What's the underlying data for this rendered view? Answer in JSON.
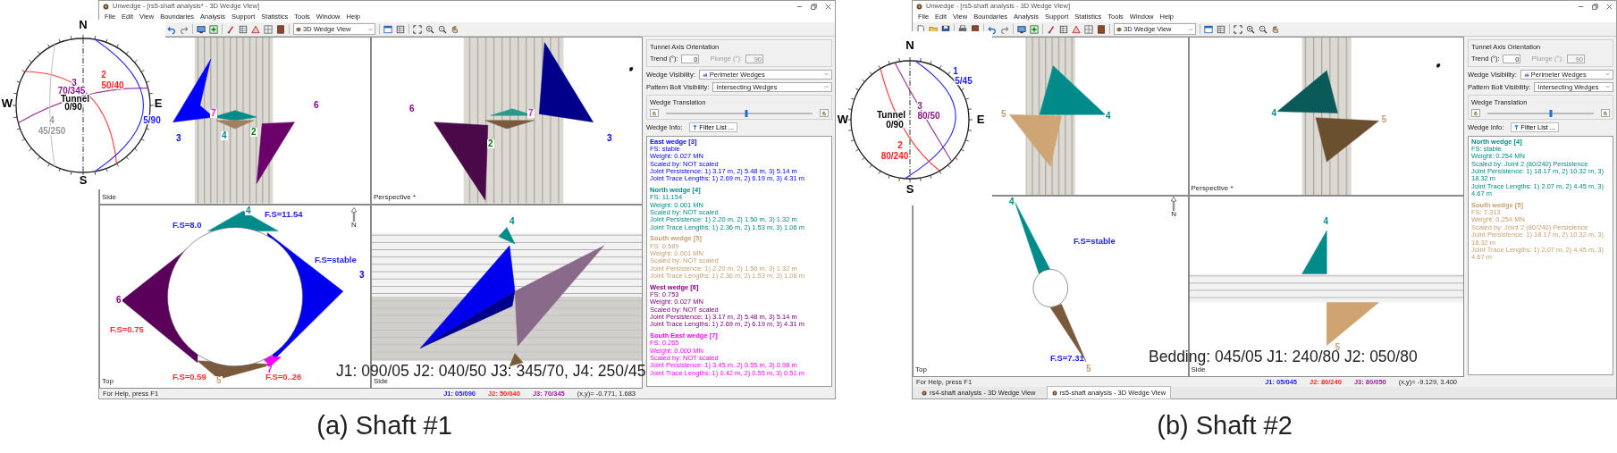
{
  "figures": [
    {
      "caption": "(a) Shaft #1",
      "annotation": "J1: 090/05 J2: 040/50 J3: 345/70, J4: 250/45",
      "stereonet": {
        "labels": [
          {
            "text": "N",
            "color": "#000000"
          },
          {
            "text": "S",
            "color": "#000000"
          },
          {
            "text": "W",
            "color": "#000000"
          },
          {
            "text": "E",
            "color": "#000000"
          },
          {
            "text": "2",
            "color": "#ff2020"
          },
          {
            "text": "50/40",
            "color": "#ff2020"
          },
          {
            "text": "3",
            "color": "#8b1a8b"
          },
          {
            "text": "70/345",
            "color": "#8b1a8b"
          },
          {
            "text": "Tunnel",
            "color": "#000000"
          },
          {
            "text": "0/90",
            "color": "#000000"
          },
          {
            "text": "4",
            "color": "#999999"
          },
          {
            "text": "45/250",
            "color": "#999999"
          },
          {
            "text": "5/90",
            "color": "#2020ff"
          }
        ],
        "planes": [
          {
            "color": "#ff4040"
          },
          {
            "color": "#9b3a9b"
          },
          {
            "color": "#c8c8c8"
          },
          {
            "color": "#3030ff"
          }
        ]
      },
      "window": {
        "title": "Unwedge - [rs5-shaft analysis* - 3D Wedge View]",
        "menu": [
          "File",
          "Edit",
          "View",
          "Boundaries",
          "Analysis",
          "Support",
          "Statistics",
          "Tools",
          "Window",
          "Help"
        ],
        "view_select": "3D Wedge View",
        "viewports": [
          {
            "label": "Side",
            "kind": "side-shaft",
            "tags": [
              {
                "text": "3",
                "color": "#0000ff"
              },
              {
                "text": "7",
                "color": "#ff00ff"
              },
              {
                "text": "4",
                "color": "#008b8b"
              },
              {
                "text": "2",
                "color": "#008000"
              },
              {
                "text": "6",
                "color": "#8b008b"
              }
            ]
          },
          {
            "label": "Perspective *",
            "kind": "perspective",
            "tags": [
              {
                "text": "6",
                "color": "#8b008b"
              },
              {
                "text": "2",
                "color": "#008000"
              },
              {
                "text": "7",
                "color": "#ff00ff"
              },
              {
                "text": "3",
                "color": "#0000ff"
              }
            ]
          },
          {
            "label": "Top",
            "kind": "top",
            "north_label": "N",
            "tags": [
              {
                "text": "4",
                "color": "#008b8b"
              },
              {
                "text": "6",
                "color": "#8b008b"
              },
              {
                "text": "3",
                "color": "#0000ff"
              },
              {
                "text": "7",
                "color": "#ff00ff"
              },
              {
                "text": "5",
                "color": "#c8a070"
              }
            ],
            "fs_labels": [
              {
                "text": "F.S=8.0",
                "color": "#2020ff"
              },
              {
                "text": "F.S=11.54",
                "color": "#2020ff"
              },
              {
                "text": "F.S=stable",
                "color": "#2020ff"
              },
              {
                "text": "F.S=0.75",
                "color": "#ff3030"
              },
              {
                "text": "F.S=0.59",
                "color": "#ff3030"
              },
              {
                "text": "F.S=0..26",
                "color": "#ff3030"
              }
            ]
          },
          {
            "label": "Side",
            "kind": "side-section",
            "tags": [
              {
                "text": "4",
                "color": "#008b8b"
              }
            ]
          }
        ],
        "panel": {
          "orientation_title": "Tunnel Axis Orientation",
          "trend_label": "Trend (°):",
          "trend": "0",
          "plunge_label": "Plunge (°):",
          "plunge": "90",
          "plunge_disabled": true,
          "wedge_visibility_label": "Wedge Visibility:",
          "wedge_visibility": "Perimeter Wedges",
          "bolt_visibility_label": "Pattern Bolt Visibility:",
          "bolt_visibility": "Intersecting Wedges",
          "translation_title": "Wedge Translation",
          "translation": {
            "level": 0.55
          },
          "info_label": "Wedge Info:",
          "filter_button": "Filter List ...",
          "wedges": [
            {
              "title": "East wedge [3]",
              "color": "#0000ff",
              "lines": [
                "FS: stable",
                "Weight: 0.027 MN",
                "Scaled by: NOT scaled",
                "Joint Persistence: 1) 3.17 m,  2) 5.48 m, 3) 5.14 m",
                "Joint Trace Lengths: 1) 2.69 m,  2) 6.19 m,  3) 4.31 m"
              ]
            },
            {
              "title": "North wedge [4]",
              "color": "#008b8b",
              "lines": [
                "FS: 11.154",
                "Weight: 0.001 MN",
                "Scaled by: NOT scaled",
                "Joint Persistence: 1) 2.20 m,  2) 1.50 m, 3) 1.32 m",
                "Joint Trace Lengths: 1) 2.36 m,  2) 1.53 m,  3) 1.06 m"
              ]
            },
            {
              "title": "South wedge [5]",
              "color": "#c8a070",
              "lines": [
                "FS: 0.589",
                "Weight: 0.001 MN",
                "Scaled by: NOT scaled",
                "Joint Persistence: 1) 2.20 m,  2) 1.50 m, 3) 1.32 m",
                "Joint Trace Lengths: 1) 2.36 m,  2) 1.53 m,  3) 1.06 m"
              ]
            },
            {
              "title": "West wedge [6]",
              "color": "#800080",
              "lines": [
                "FS: 0.753",
                "Weight: 0.027 MN",
                "Scaled by: NOT scaled",
                "Joint Persistence: 1) 3.17 m,  2) 5.48 m, 3) 5.14 m",
                "Joint Trace Lengths: 1) 2.69 m,  2) 6.19 m,  3) 4.31 m"
              ]
            },
            {
              "title": "South East wedge [7]",
              "color": "#ff00ff",
              "lines": [
                "FS: 0.265",
                "Weight: 0.000 MN",
                "Scaled by: NOT scaled",
                "Joint Persistence: 1) 3.45 m,  2) 0.55 m, 3) 0.98 m",
                "Joint Trace Lengths: 1) 0.42 m,  2) 0.55 m,  3) 0.51 m"
              ]
            }
          ]
        },
        "status": {
          "help": "For Help, press F1",
          "joints": [
            {
              "text": "J1: 05/090",
              "color": "#2020ff"
            },
            {
              "text": "J2: 50/040",
              "color": "#ff2020"
            },
            {
              "text": "J3: 70/345",
              "color": "#a020a0"
            }
          ],
          "coords": "(x,y)= -0.771, 1.683"
        }
      }
    },
    {
      "caption": "(b) Shaft #2",
      "annotation": "Bedding: 045/05 J1: 240/80 J2: 050/80",
      "stereonet": {
        "labels": [
          {
            "text": "N",
            "color": "#000000"
          },
          {
            "text": "S",
            "color": "#000000"
          },
          {
            "text": "W",
            "color": "#000000"
          },
          {
            "text": "E",
            "color": "#000000"
          },
          {
            "text": "1",
            "color": "#2020ff"
          },
          {
            "text": "5/45",
            "color": "#2020ff"
          },
          {
            "text": "Tunnel",
            "color": "#000000"
          },
          {
            "text": "0/90",
            "color": "#000000"
          },
          {
            "text": "3",
            "color": "#8b1a8b"
          },
          {
            "text": "80/50",
            "color": "#8b1a8b"
          },
          {
            "text": "2",
            "color": "#ff2020"
          },
          {
            "text": "80/240",
            "color": "#ff2020"
          }
        ],
        "planes": [
          {
            "color": "#3030ff"
          },
          {
            "color": "#ff4040"
          },
          {
            "color": "#9b3a9b"
          }
        ]
      },
      "window": {
        "title": "Unwedge - [rs5-shaft analysis - 3D Wedge View]",
        "menu": [
          "File",
          "Edit",
          "View",
          "Boundaries",
          "Analysis",
          "Support",
          "Statistics",
          "Tools",
          "Window",
          "Help"
        ],
        "view_select": "3D Wedge View",
        "viewports": [
          {
            "kind": "side-shaft",
            "tags": [
              {
                "text": "5",
                "color": "#c8a070"
              },
              {
                "text": "4",
                "color": "#008b8b"
              }
            ]
          },
          {
            "label": "Perspective *",
            "kind": "perspective",
            "tags": [
              {
                "text": "4",
                "color": "#008b8b"
              },
              {
                "text": "5",
                "color": "#c8a070"
              }
            ]
          },
          {
            "label": "Top",
            "kind": "top",
            "north_label": "N",
            "tags": [
              {
                "text": "4",
                "color": "#008b8b"
              },
              {
                "text": "5",
                "color": "#c8a070"
              }
            ],
            "fs_labels": [
              {
                "text": "F.S=stable",
                "color": "#2020ff"
              },
              {
                "text": "F.S=7.31",
                "color": "#2020ff"
              }
            ]
          },
          {
            "label": "Side",
            "kind": "side-section",
            "tags": [
              {
                "text": "4",
                "color": "#008b8b"
              },
              {
                "text": "5",
                "color": "#c8a070"
              }
            ]
          }
        ],
        "panel": {
          "orientation_title": "Tunnel Axis Orientation",
          "trend_label": "Trend (°):",
          "trend": "0",
          "plunge_label": "Plunge (°):",
          "plunge": "90",
          "plunge_disabled": true,
          "wedge_visibility_label": "Wedge Visibility:",
          "wedge_visibility": "Perimeter Wedges",
          "bolt_visibility_label": "Pattern Bolt Visibility:",
          "bolt_visibility": "Intersecting Wedges",
          "translation_title": "Wedge Translation",
          "translation": {
            "level": 0.6
          },
          "info_label": "Wedge Info:",
          "filter_button": "Filter List ...",
          "wedges": [
            {
              "title": "North wedge [4]",
              "color": "#008b8b",
              "lines": [
                "FS: stable",
                "Weight: 0.254 MN",
                "Scaled by: Joint 2 (80/240) Persistence",
                "Joint Persistence: 1) 18.17 m,  2) 10.32 m, 3) 18.32 m",
                "Joint Trace Lengths: 1) 2.07 m,  2) 4.45 m, 3) 4.67 m"
              ]
            },
            {
              "title": "South wedge [5]",
              "color": "#c8a070",
              "lines": [
                "FS: 7.313",
                "Weight: 0.254 MN",
                "Scaled by: Joint 2 (80/240) Persistence",
                "Joint Persistence: 1) 18.17 m,  2) 10.32 m, 3) 18.32 m",
                "Joint Trace Lengths: 1) 2.07 m,  2) 4.45 m, 3) 4.67 m"
              ]
            }
          ]
        },
        "status": {
          "help": "For Help, press F1",
          "joints": [
            {
              "text": "J1: 05/045",
              "color": "#2020ff"
            },
            {
              "text": "J2: 80/240",
              "color": "#ff2020"
            },
            {
              "text": "J3: 80/050",
              "color": "#a020a0"
            }
          ],
          "coords": "(x,y)= -9.129, 3.400"
        },
        "doc_tabs": [
          {
            "label": "rs4-shaft analysis - 3D Wedge View",
            "selected": false
          },
          {
            "label": "rs5-shaft analysis - 3D Wedge View",
            "selected": true
          }
        ]
      }
    }
  ]
}
